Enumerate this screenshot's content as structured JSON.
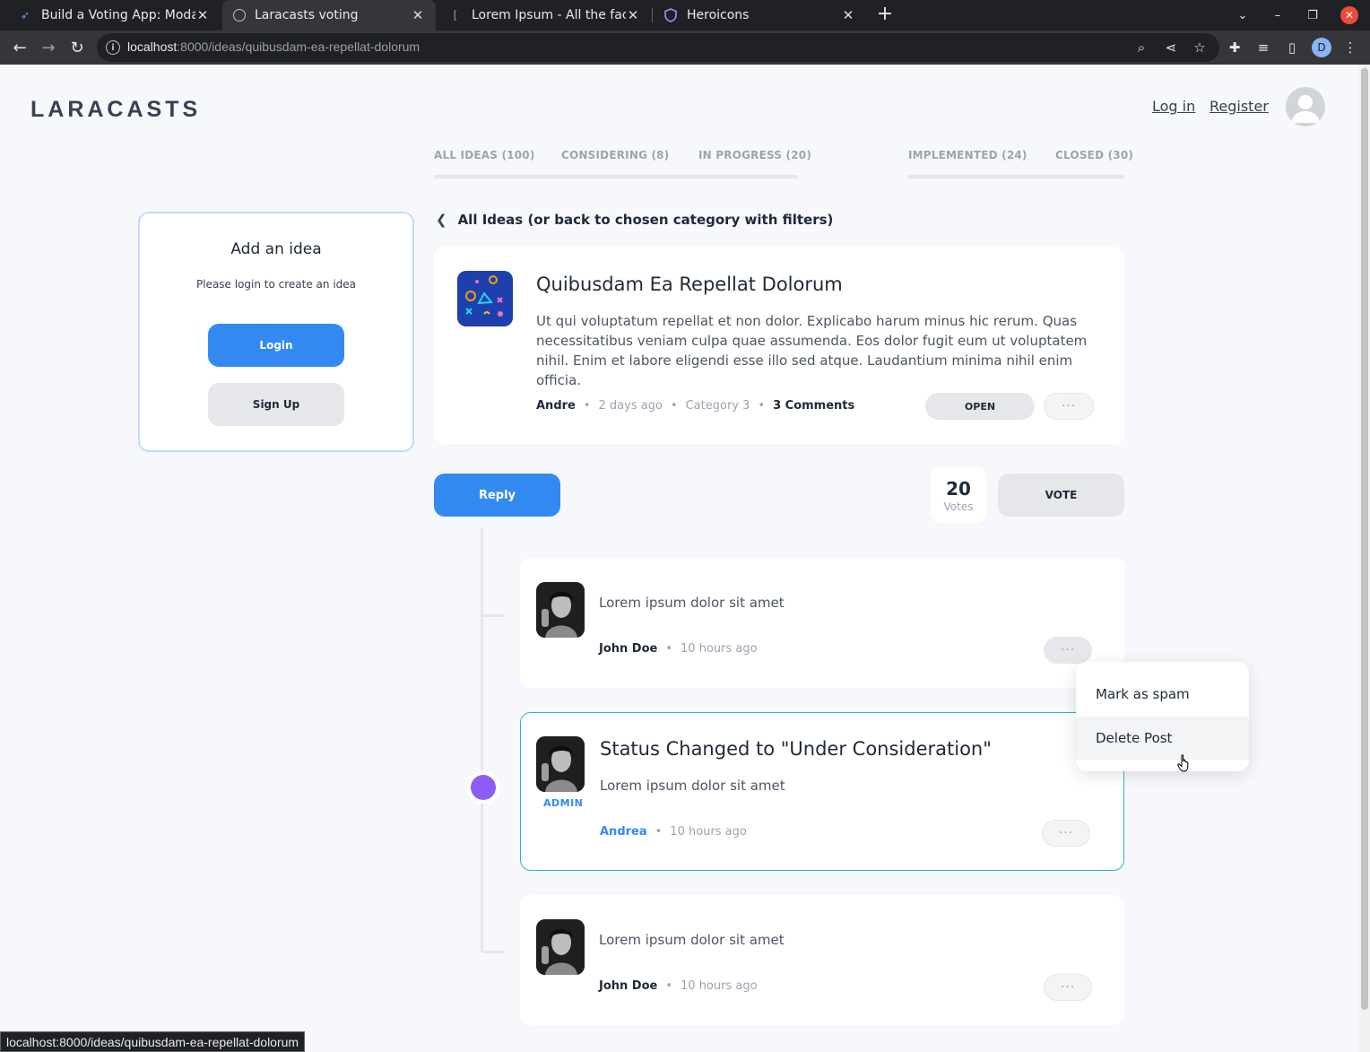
{
  "browser": {
    "tabs": [
      {
        "title": "Build a Voting App: Moda",
        "icon": "laracasts-favicon"
      },
      {
        "title": "Laracasts voting",
        "icon": "globe-icon"
      },
      {
        "title": "Lorem Ipsum - All the fact",
        "icon": "lorem-favicon"
      },
      {
        "title": "Heroicons",
        "icon": "shield-icon"
      }
    ],
    "url_host": "localhost",
    "url_path": ":8000/ideas/quibusdam-ea-repellat-dolorum",
    "profile_initial": "D",
    "status_url": "localhost:8000/ideas/quibusdam-ea-repellat-dolorum"
  },
  "header": {
    "logo": "LARACASTS",
    "login": "Log in",
    "register": "Register"
  },
  "nav": {
    "tabs": [
      {
        "label": "ALL IDEAS (100)"
      },
      {
        "label": "CONSIDERING (8)"
      },
      {
        "label": "IN PROGRESS (20)"
      },
      {
        "label": "IMPLEMENTED (24)"
      },
      {
        "label": "CLOSED (30)"
      }
    ]
  },
  "sidebar": {
    "title": "Add an idea",
    "subtitle": "Please login to create an idea",
    "login_btn": "Login",
    "signup_btn": "Sign Up"
  },
  "back_link": "All Ideas (or back to chosen category with filters)",
  "idea": {
    "title": "Quibusdam Ea Repellat Dolorum",
    "description": "Ut qui voluptatum repellat et non dolor. Explicabo harum minus hic rerum. Quas necessitatibus veniam culpa quae assumenda. Eos dolor fugit eum ut voluptatem nihil. Enim et labore eligendi esse illo sed atque. Laudantium minima nihil enim officia.",
    "author": "Andre",
    "time": "2 days ago",
    "category": "Category 3",
    "comments": "3 Comments",
    "status": "OPEN",
    "more": "···"
  },
  "actions": {
    "reply": "Reply",
    "votes_count": "20",
    "votes_label": "Votes",
    "vote_btn": "VOTE"
  },
  "comments": [
    {
      "text": "Lorem ipsum dolor sit amet",
      "author": "John Doe",
      "time": "10 hours ago",
      "more": "···"
    },
    {
      "title": "Status Changed to \"Under Consideration\"",
      "text": "Lorem ipsum dolor sit amet",
      "author": "Andrea",
      "time": "10 hours ago",
      "badge": "ADMIN",
      "more": "···"
    },
    {
      "text": "Lorem ipsum dolor sit amet",
      "author": "John Doe",
      "time": "10 hours ago",
      "more": "···"
    }
  ],
  "dropdown": {
    "items": [
      "Mark as spam",
      "Delete Post"
    ]
  },
  "colors": {
    "accent_blue": "#328af1",
    "admin_border": "#2ab0d0",
    "status_dot": "#8b5cf6"
  }
}
